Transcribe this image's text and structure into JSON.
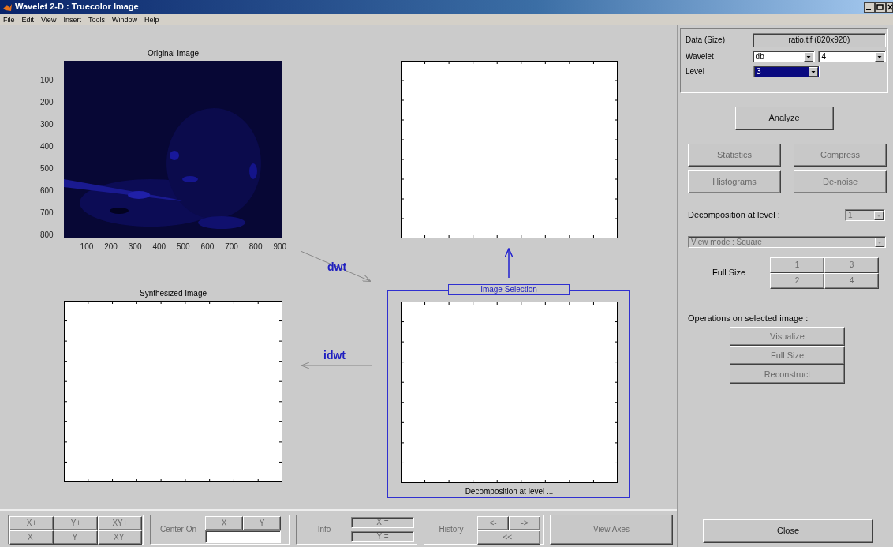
{
  "window": {
    "title": "Wavelet 2-D : Truecolor Image"
  },
  "menu": [
    "File",
    "Edit",
    "View",
    "Insert",
    "Tools",
    "Window",
    "Help"
  ],
  "axes": [
    {
      "title": "Original Image",
      "xticks": [
        "100",
        "200",
        "300",
        "400",
        "500",
        "600",
        "700",
        "800",
        "900"
      ],
      "yticks": [
        "100",
        "200",
        "300",
        "400",
        "500",
        "600",
        "700",
        "800"
      ]
    },
    {
      "kind": "empty"
    },
    {
      "kind": "empty",
      "title": "Synthesized Image"
    },
    {
      "kind": "empty",
      "xlabel": "Decomposition at level ..."
    }
  ],
  "arrows": [
    {
      "label": "dwt"
    },
    {
      "label": "idwt"
    }
  ],
  "selection_frame": {
    "title": "Image Selection"
  },
  "panel": {
    "data_label": "Data (Size)",
    "data_value": "ratio.tif (820x920)",
    "wavelet_label": "Wavelet",
    "wavelet_family": "db",
    "wavelet_order": "4",
    "level_label": "Level",
    "level": {
      "value": "3",
      "focused": true
    }
  },
  "analyze": {
    "label": "Analyze",
    "disabled": false
  },
  "tools": [
    {
      "label": "Statistics",
      "disabled": true
    },
    {
      "label": "Compress",
      "disabled": true
    },
    {
      "label": "Histograms",
      "disabled": true
    },
    {
      "label": "De-noise",
      "disabled": true
    }
  ],
  "decomposition": {
    "label": "Decomposition at level :",
    "value": "1",
    "disabled": true
  },
  "view_mode": {
    "value": "View mode : Square",
    "disabled": true
  },
  "full_size": {
    "label": "Full Size",
    "buttons": [
      {
        "label": "1",
        "disabled": true
      },
      {
        "label": "3",
        "disabled": true
      },
      {
        "label": "2",
        "disabled": true
      },
      {
        "label": "4",
        "disabled": true
      }
    ]
  },
  "operations": {
    "label": "Operations on selected image :",
    "buttons": [
      {
        "label": "Visualize",
        "disabled": true
      },
      {
        "label": "Full Size",
        "disabled": true
      },
      {
        "label": "Reconstruct",
        "disabled": true
      }
    ]
  },
  "close": {
    "label": "Close",
    "disabled": false
  },
  "toolbar": {
    "zoom_buttons": [
      {
        "label": "X+",
        "disabled": true
      },
      {
        "label": "Y+",
        "disabled": true
      },
      {
        "label": "XY+",
        "disabled": true
      },
      {
        "label": "X-",
        "disabled": true
      },
      {
        "label": "Y-",
        "disabled": true
      },
      {
        "label": "XY-",
        "disabled": true
      }
    ],
    "center_on": {
      "label": "Center On",
      "buttons": [
        {
          "label": "X",
          "disabled": true
        },
        {
          "label": "Y",
          "disabled": true
        }
      ]
    },
    "info": {
      "label": "Info",
      "x": "X =",
      "y": "Y ="
    },
    "history": {
      "label": "History",
      "buttons": [
        {
          "label": "<-",
          "disabled": true
        },
        {
          "label": "->",
          "disabled": true
        },
        {
          "label": "<<-",
          "disabled": true
        }
      ]
    },
    "view_axes": {
      "label": "View Axes",
      "disabled": true
    }
  }
}
